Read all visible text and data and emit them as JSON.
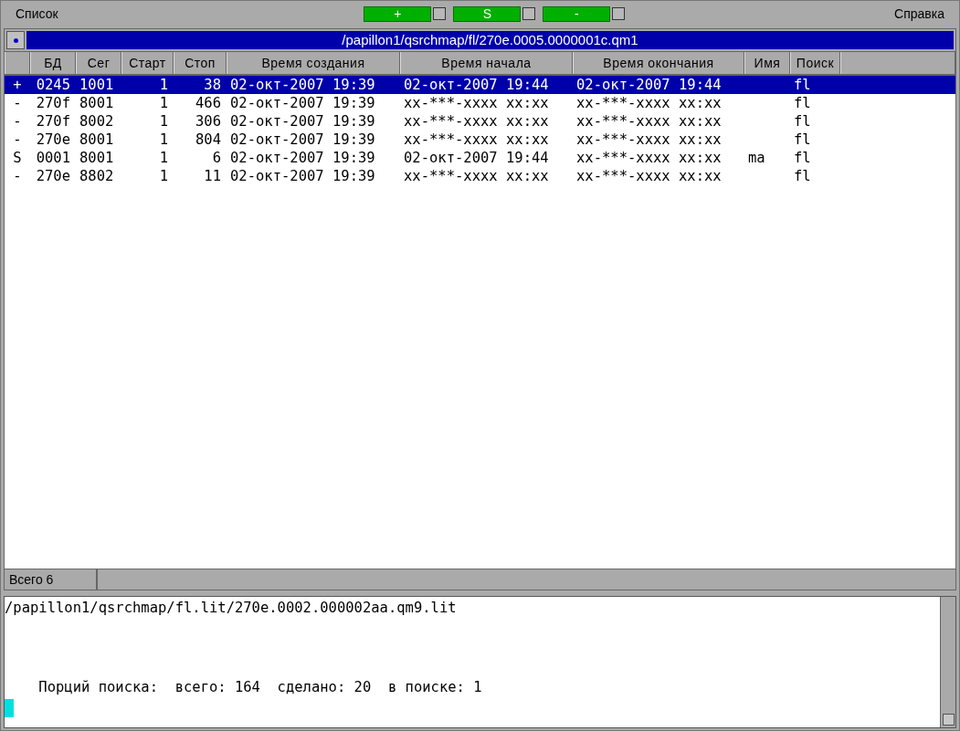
{
  "menu": {
    "left": "Список",
    "right": "Справка"
  },
  "toggles": [
    {
      "label": "+",
      "on": false
    },
    {
      "label": "S",
      "on": false
    },
    {
      "label": "-",
      "on": false
    }
  ],
  "window": {
    "title": "/papillon1/qsrchmap/fl/270e.0005.0000001c.qm1"
  },
  "table": {
    "columns": [
      "",
      "БД",
      "Сег",
      "Старт",
      "Стоп",
      "Время создания",
      "Время начала",
      "Время окончания",
      "Имя",
      "Поиск"
    ],
    "rows": [
      {
        "selected": true,
        "cells": [
          "+",
          "0245",
          "1001",
          "1",
          "38",
          "02-окт-2007 19:39",
          "02-окт-2007 19:44",
          "02-окт-2007 19:44",
          "",
          "fl"
        ]
      },
      {
        "selected": false,
        "cells": [
          "-",
          "270f",
          "8001",
          "1",
          "466",
          "02-окт-2007 19:39",
          "xx-***-xxxx xx:xx",
          "xx-***-xxxx xx:xx",
          "",
          "fl"
        ]
      },
      {
        "selected": false,
        "cells": [
          "-",
          "270f",
          "8002",
          "1",
          "306",
          "02-окт-2007 19:39",
          "xx-***-xxxx xx:xx",
          "xx-***-xxxx xx:xx",
          "",
          "fl"
        ]
      },
      {
        "selected": false,
        "cells": [
          "-",
          "270e",
          "8001",
          "1",
          "804",
          "02-окт-2007 19:39",
          "xx-***-xxxx xx:xx",
          "xx-***-xxxx xx:xx",
          "",
          "fl"
        ]
      },
      {
        "selected": false,
        "cells": [
          "S",
          "0001",
          "8001",
          "1",
          "6",
          "02-окт-2007 19:39",
          "02-окт-2007 19:44",
          "xx-***-xxxx xx:xx",
          "ma",
          "fl"
        ]
      },
      {
        "selected": false,
        "cells": [
          "-",
          "270e",
          "8802",
          "1",
          "11",
          "02-окт-2007 19:39",
          "xx-***-xxxx xx:xx",
          "xx-***-xxxx xx:xx",
          "",
          "fl"
        ]
      }
    ]
  },
  "status_bar": {
    "total": "Всего 6"
  },
  "console": {
    "path": "/papillon1/qsrchmap/fl.lit/270e.0002.000002aa.qm9.lit",
    "progress": "    Порций поиска:  всего: 164  сделано: 20  в поиске: 1"
  }
}
